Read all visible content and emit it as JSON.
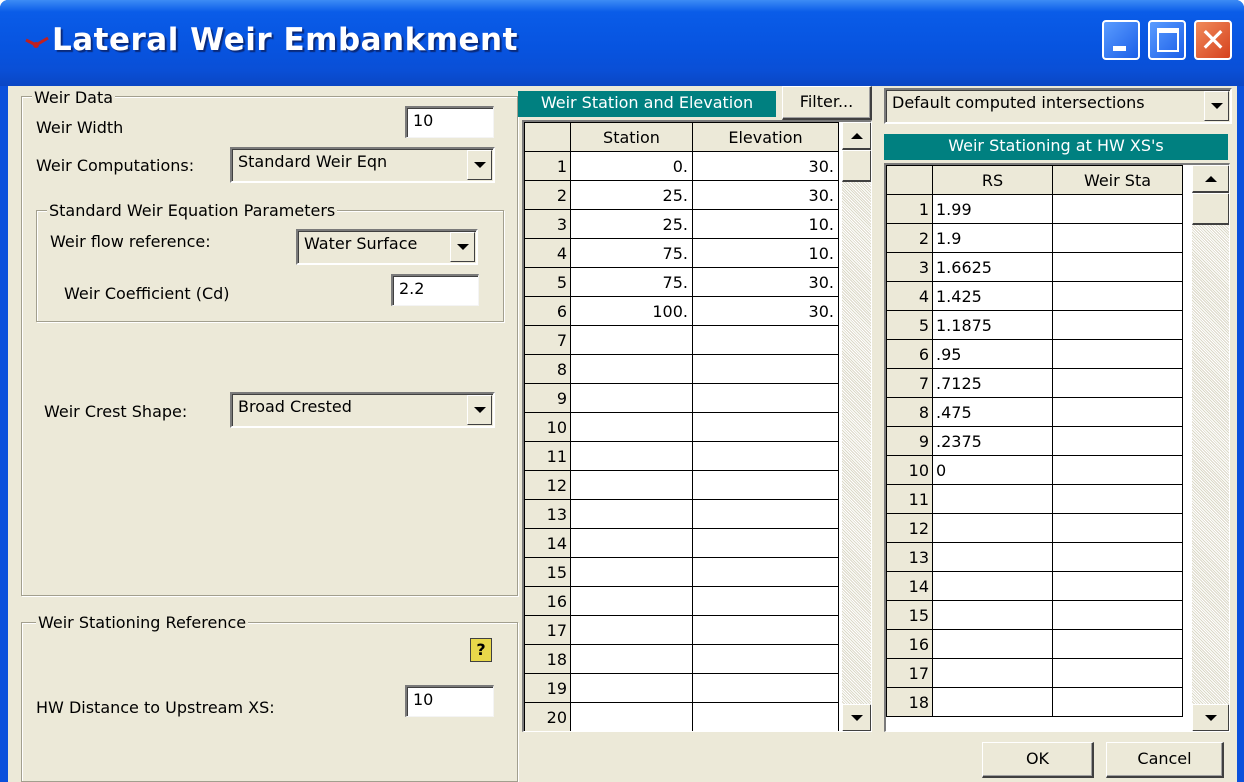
{
  "window": {
    "title": "Lateral Weir Embankment"
  },
  "weir_data": {
    "group_label": "Weir Data",
    "width_label": "Weir Width",
    "width_value": "10",
    "computations_label": "Weir Computations:",
    "computations_value": "Standard Weir Eqn",
    "params_group_label": "Standard Weir Equation Parameters",
    "flow_ref_label": "Weir flow reference:",
    "flow_ref_value": "Water Surface",
    "coef_label": "Weir Coefficient (Cd)",
    "coef_value": "2.2",
    "crest_label": "Weir Crest Shape:",
    "crest_value": "Broad Crested"
  },
  "stationing_ref": {
    "group_label": "Weir Stationing Reference",
    "help_glyph": "?",
    "hw_label": "HW Distance to Upstream XS:",
    "hw_value": "10"
  },
  "station_table": {
    "header": "Weir Station and Elevation",
    "filter_label": "Filter...",
    "columns": [
      "Station",
      "Elevation"
    ],
    "rows": [
      {
        "n": "1",
        "station": "0.",
        "elevation": "30."
      },
      {
        "n": "2",
        "station": "25.",
        "elevation": "30."
      },
      {
        "n": "3",
        "station": "25.",
        "elevation": "10."
      },
      {
        "n": "4",
        "station": "75.",
        "elevation": "10."
      },
      {
        "n": "5",
        "station": "75.",
        "elevation": "30."
      },
      {
        "n": "6",
        "station": "100.",
        "elevation": "30."
      },
      {
        "n": "7",
        "station": "",
        "elevation": ""
      },
      {
        "n": "8",
        "station": "",
        "elevation": ""
      },
      {
        "n": "9",
        "station": "",
        "elevation": ""
      },
      {
        "n": "10",
        "station": "",
        "elevation": ""
      },
      {
        "n": "11",
        "station": "",
        "elevation": ""
      },
      {
        "n": "12",
        "station": "",
        "elevation": ""
      },
      {
        "n": "13",
        "station": "",
        "elevation": ""
      },
      {
        "n": "14",
        "station": "",
        "elevation": ""
      },
      {
        "n": "15",
        "station": "",
        "elevation": ""
      },
      {
        "n": "16",
        "station": "",
        "elevation": ""
      },
      {
        "n": "17",
        "station": "",
        "elevation": ""
      },
      {
        "n": "18",
        "station": "",
        "elevation": ""
      },
      {
        "n": "19",
        "station": "",
        "elevation": ""
      },
      {
        "n": "20",
        "station": "",
        "elevation": ""
      }
    ]
  },
  "hw_table": {
    "intersections_value": "Default computed intersections",
    "header": "Weir Stationing at HW XS's",
    "columns": [
      "RS",
      "Weir Sta"
    ],
    "rows": [
      {
        "n": "1",
        "rs": "1.99",
        "sta": ""
      },
      {
        "n": "2",
        "rs": "1.9",
        "sta": ""
      },
      {
        "n": "3",
        "rs": "1.6625",
        "sta": ""
      },
      {
        "n": "4",
        "rs": "1.425",
        "sta": ""
      },
      {
        "n": "5",
        "rs": "1.1875",
        "sta": ""
      },
      {
        "n": "6",
        "rs": ".95",
        "sta": ""
      },
      {
        "n": "7",
        "rs": ".7125",
        "sta": ""
      },
      {
        "n": "8",
        "rs": ".475",
        "sta": ""
      },
      {
        "n": "9",
        "rs": ".2375",
        "sta": ""
      },
      {
        "n": "10",
        "rs": "0",
        "sta": ""
      },
      {
        "n": "11",
        "rs": "",
        "sta": ""
      },
      {
        "n": "12",
        "rs": "",
        "sta": ""
      },
      {
        "n": "13",
        "rs": "",
        "sta": ""
      },
      {
        "n": "14",
        "rs": "",
        "sta": ""
      },
      {
        "n": "15",
        "rs": "",
        "sta": ""
      },
      {
        "n": "16",
        "rs": "",
        "sta": ""
      },
      {
        "n": "17",
        "rs": "",
        "sta": ""
      },
      {
        "n": "18",
        "rs": "",
        "sta": ""
      }
    ]
  },
  "buttons": {
    "ok": "OK",
    "cancel": "Cancel"
  }
}
